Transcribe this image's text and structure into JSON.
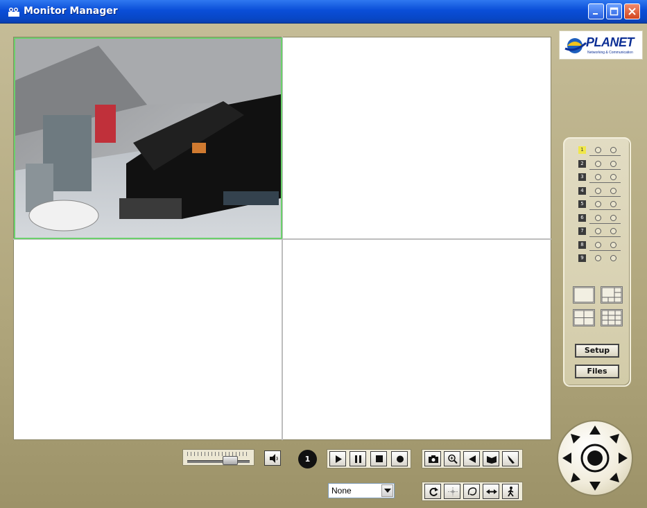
{
  "window": {
    "title": "Monitor Manager",
    "buttons": [
      "minimize",
      "maximize",
      "close"
    ]
  },
  "brand": {
    "logo_text": "PLANET",
    "logo_subtext": "Networking & Communication"
  },
  "video_grid": {
    "layout": "2x2",
    "cells": [
      {
        "id": 1,
        "has_video": true,
        "selected": true
      },
      {
        "id": 2,
        "has_video": false,
        "selected": false
      },
      {
        "id": 3,
        "has_video": false,
        "selected": false
      },
      {
        "id": 4,
        "has_video": false,
        "selected": false
      }
    ],
    "selected_border_color": "#6bd06b"
  },
  "camera_list": {
    "cameras": [
      {
        "number": "1",
        "active": true
      },
      {
        "number": "2",
        "active": false
      },
      {
        "number": "3",
        "active": false
      },
      {
        "number": "4",
        "active": false
      },
      {
        "number": "5",
        "active": false
      },
      {
        "number": "6",
        "active": false
      },
      {
        "number": "7",
        "active": false
      },
      {
        "number": "8",
        "active": false
      },
      {
        "number": "9",
        "active": false
      }
    ],
    "layout_buttons": [
      "layout-1x1",
      "layout-1plus5",
      "layout-2x2",
      "layout-3x3"
    ]
  },
  "side_buttons": {
    "setup": "Setup",
    "files": "Files"
  },
  "toolbar": {
    "channel_label": "1",
    "volume_level": 0.7,
    "playback": [
      "play-icon",
      "pause-icon",
      "stop-icon",
      "record-icon"
    ],
    "tools_row1": [
      "snapshot-icon",
      "zoom-icon",
      "audio-out-icon",
      "book-icon",
      "pen-icon"
    ],
    "tools_row2": [
      "refresh-icon",
      "focus-icon",
      "auto-pan-icon",
      "pan-icon",
      "motion-icon"
    ],
    "preset_select": "None"
  },
  "ptz": {
    "directions": [
      "up",
      "up-right",
      "right",
      "down-right",
      "down",
      "down-left",
      "left",
      "up-left"
    ],
    "center": "home"
  }
}
